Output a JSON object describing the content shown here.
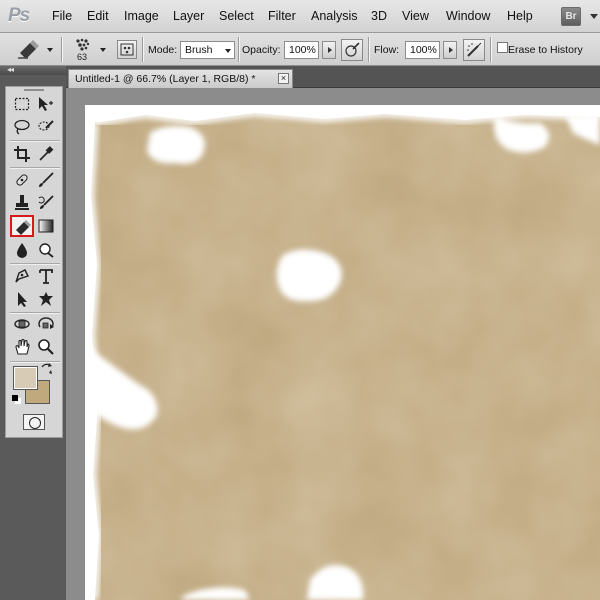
{
  "app": {
    "logo": "Ps",
    "bridge_badge": "Br"
  },
  "menu": {
    "items": [
      "File",
      "Edit",
      "Image",
      "Layer",
      "Select",
      "Filter",
      "Analysis",
      "3D",
      "View",
      "Window",
      "Help"
    ]
  },
  "options_bar": {
    "brush_size": "63",
    "mode_label": "Mode:",
    "mode_value": "Brush",
    "opacity_label": "Opacity:",
    "opacity_value": "100%",
    "flow_label": "Flow:",
    "flow_value": "100%",
    "erase_to_history_label": "Erase to History",
    "erase_to_history_checked": false
  },
  "document": {
    "tab_title": "Untitled-1 @ 66.7% (Layer 1, RGB/8) *",
    "close_glyph": "×"
  },
  "tools_panel": {
    "collapse_glyph": "◂◂",
    "active_tool": "eraser-tool",
    "tools": [
      "rectangular-marquee",
      "move",
      "lasso",
      "quick-selection",
      "crop",
      "eyedropper",
      "spot-healing-brush",
      "brush",
      "clone-stamp",
      "history-brush",
      "eraser",
      "gradient",
      "blur",
      "dodge",
      "pen",
      "type",
      "path-selection",
      "custom-shape",
      "3d-rotate",
      "3d-orbit",
      "hand",
      "zoom"
    ]
  },
  "colors": {
    "foreground": "#d8cbb5",
    "background": "#c0a97c",
    "highlight": "#d7191c",
    "parchment": "#c2a97e"
  }
}
